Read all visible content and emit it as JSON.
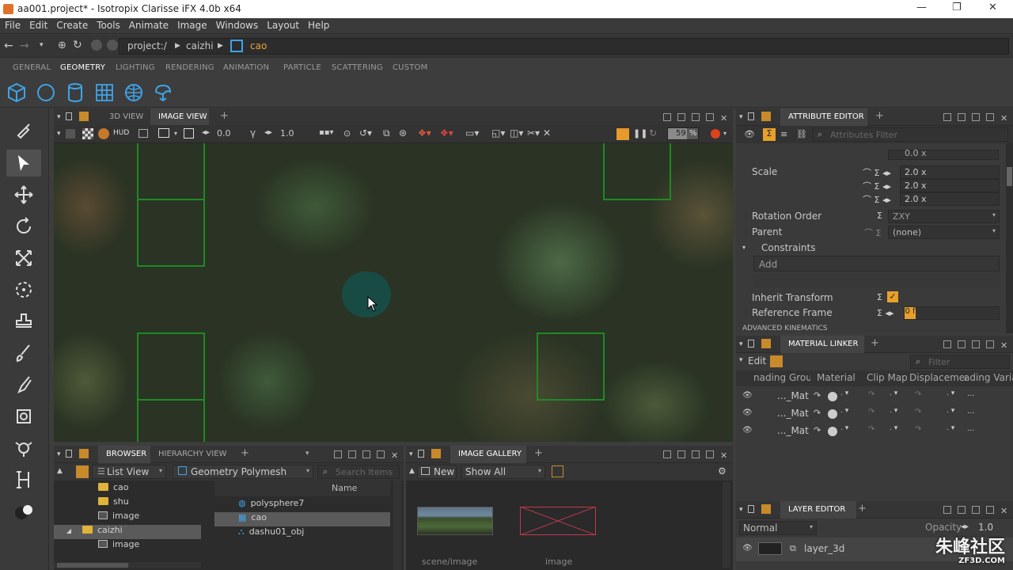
{
  "title": "aa001.project* - Isotropix Clarisse iFX 4.0b x64",
  "menu": [
    "File",
    "Edit",
    "Create",
    "Tools",
    "Animate",
    "Image",
    "Windows",
    "Layout",
    "Help"
  ],
  "path": {
    "seg1": "project:/",
    "seg2": "caizhi",
    "seg3": "cao"
  },
  "shelf_tabs": [
    "GENERAL",
    "GEOMETRY",
    "LIGHTING",
    "RENDERING",
    "ANIMATION",
    "PARTICLE",
    "SCATTERING",
    "CUSTOM"
  ],
  "shelf_active": "GEOMETRY",
  "viewer": {
    "tab1": "3D VIEW",
    "tab2": "IMAGE VIEW",
    "hud": "HUD",
    "exposure": "0.0",
    "gamma": "1.0",
    "zoom": "59",
    "zoom_unit": "%"
  },
  "attr": {
    "title": "ATTRIBUTE EDITOR",
    "filter_placeholder": "Attributes Filter",
    "top_val": "0.0 x",
    "scale_label": "Scale",
    "scale_x": "2.0 x",
    "scale_y": "2.0 x",
    "scale_z": "2.0 x",
    "rot_order_label": "Rotation Order",
    "rot_order": "ZXY",
    "parent_label": "Parent",
    "parent": "(none)",
    "constraints": "Constraints",
    "add": "Add",
    "inherit_label": "Inherit Transform",
    "ref_label": "Reference Frame",
    "ref_value": "0 f",
    "adv": "ADVANCED KINEMATICS"
  },
  "matlinker": {
    "title": "MATERIAL LINKER",
    "edit": "Edit",
    "filter_placeholder": "Filter",
    "cols": [
      "nading Grou",
      "Material",
      "Clip Map",
      "Displacemen",
      "ading Variab"
    ],
    "rows": [
      "..._Mat",
      "..._Mat",
      "..._Mat"
    ]
  },
  "layer": {
    "title": "LAYER EDITOR",
    "blend": "Normal",
    "opacity_label": "Opacity",
    "opacity": "1.0",
    "layer": "layer_3d"
  },
  "browser": {
    "tab1": "BROWSER",
    "tab2": "HIERARCHY VIEW",
    "view": "List View",
    "filter": "Geometry Polymesh",
    "search_placeholder": "Search Items",
    "name_col": "Name",
    "tree": [
      "cao",
      "shu",
      "image",
      "caizhi",
      "image"
    ],
    "items": [
      "polysphere7",
      "cao",
      "dashu01_obj"
    ]
  },
  "gallery": {
    "title": "IMAGE GALLERY",
    "new": "New",
    "show": "Show All",
    "cap1": "scene/image",
    "cap2": "image"
  },
  "watermark": "朱峰社区",
  "watermark_sub": "ZF3D.COM"
}
